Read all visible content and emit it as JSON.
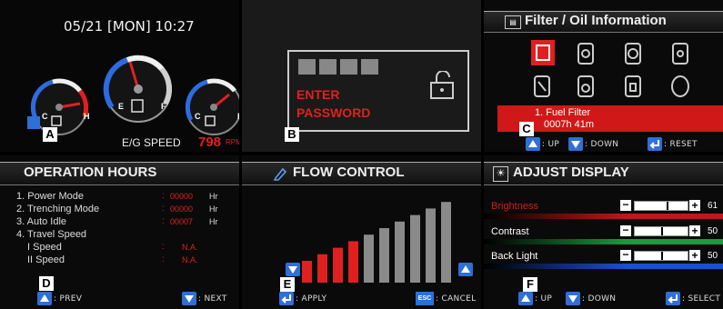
{
  "panelA": {
    "letter": "A",
    "datetime": "05/21 [MON] 10:27",
    "speed_label": "E/G SPEED",
    "speed_value": "798",
    "speed_unit": "RPM",
    "gauge_left": {
      "low": "C",
      "high": "H"
    },
    "gauge_center": {
      "low": "E",
      "high": "F"
    },
    "gauge_right": {
      "low": "C",
      "high": "H"
    }
  },
  "panelB": {
    "letter": "B",
    "line1": "ENTER",
    "line2": "PASSWORD"
  },
  "panelC": {
    "letter": "C",
    "title": "Filter / Oil Information",
    "item_line1": "1. Fuel Filter",
    "item_line2": "0007h   41m",
    "footer": {
      "up": ": UP",
      "down": ": DOWN",
      "reset": ": RESET"
    }
  },
  "panelD": {
    "letter": "D",
    "title": "OPERATION HOURS",
    "rows": [
      {
        "label": "1. Power Mode",
        "value": "00000",
        "unit": "Hr"
      },
      {
        "label": "2. Trenching Mode",
        "value": "00000",
        "unit": "Hr"
      },
      {
        "label": "3. Auto Idle",
        "value": "00007",
        "unit": "Hr"
      },
      {
        "label": "4. Travel Speed",
        "value": "",
        "unit": ""
      },
      {
        "label": "I Speed",
        "value": "N.A.",
        "unit": ""
      },
      {
        "label": "II Speed",
        "value": "N.A.",
        "unit": ""
      }
    ],
    "colon": ":",
    "footer": {
      "prev": ": PREV",
      "next": ": NEXT"
    }
  },
  "panelE": {
    "letter": "E",
    "title": "FLOW CONTROL",
    "bars_total": 10,
    "bars_active": 4,
    "footer": {
      "apply": ": APPLY",
      "esc": "ESC",
      "cancel": ": CANCEL"
    }
  },
  "panelF": {
    "letter": "F",
    "title": "ADJUST DISPLAY",
    "settings": [
      {
        "label": "Brightness",
        "value": "61",
        "level": 0.61,
        "color": "#d02020",
        "bar": "#c01818"
      },
      {
        "label": "Contrast",
        "value": "50",
        "level": 0.5,
        "color": "#ffffff",
        "bar": "#1c9a3a"
      },
      {
        "label": "Back Light",
        "value": "50",
        "level": 0.5,
        "color": "#ffffff",
        "bar": "#1d4fd0"
      }
    ],
    "footer": {
      "up": ": UP",
      "down": ": DOWN",
      "select": ": SELECT"
    }
  },
  "colors": {
    "accent_red": "#e02020",
    "button_blue": "#2f6fd6"
  }
}
